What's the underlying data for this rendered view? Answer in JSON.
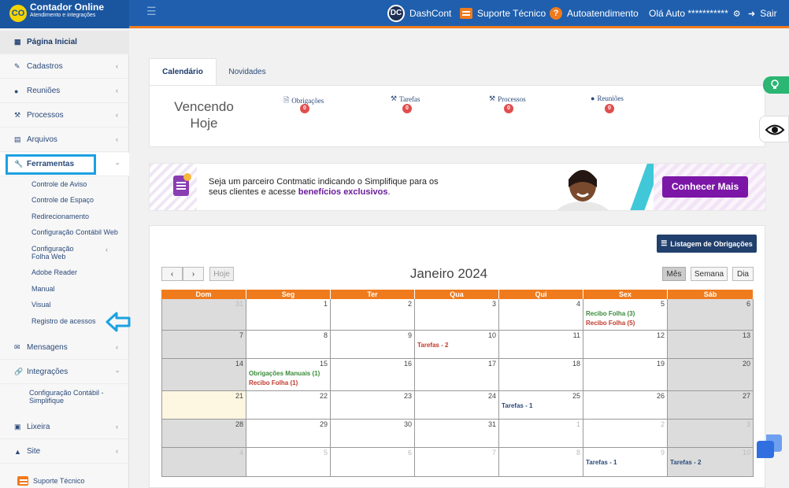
{
  "topbar": {
    "brand_logo": "CO",
    "brand_name": "Contador Online",
    "brand_sub": "Atendimento e integrações",
    "dashcont_logo": "DC",
    "dashcont": "DashCont",
    "suporte": "Suporte Técnico",
    "autoatendimento": "Autoatendimento",
    "user_greeting": "Olá Auto ***********",
    "sair": "Sair"
  },
  "sidebar": {
    "home": "Página Inicial",
    "items": [
      {
        "label": "Cadastros",
        "icon": "edit-icon"
      },
      {
        "label": "Reuniões",
        "icon": "users-icon"
      },
      {
        "label": "Processos",
        "icon": "gavel-icon"
      },
      {
        "label": "Arquivos",
        "icon": "file-icon"
      },
      {
        "label": "Ferramentas",
        "icon": "wrench-icon"
      },
      {
        "label": "Mensagens",
        "icon": "envelope-icon"
      },
      {
        "label": "Integrações",
        "icon": "link-icon"
      },
      {
        "label": "Lixeira",
        "icon": "trash-icon"
      },
      {
        "label": "Site",
        "icon": "sitemap-icon"
      }
    ],
    "ferramentas_sub": [
      "Controle de Aviso",
      "Controle de Espaço",
      "Redirecionamento",
      "Configuração Contábil Web",
      "Configuração Folha Web",
      "Adobe Reader",
      "Manual",
      "Visual",
      "Registro de acessos"
    ],
    "integracoes_sub": "Configuração Contábil - Simplifique",
    "suporte": "Suporte Técnico"
  },
  "tabs": [
    "Calendário",
    "Novidades"
  ],
  "summary": {
    "title": "Vencendo Hoje",
    "counters": [
      {
        "label": "Obrigações",
        "count": "0"
      },
      {
        "label": "Tarefas",
        "count": "0"
      },
      {
        "label": "Processos",
        "count": "0"
      },
      {
        "label": "Reuniões",
        "count": "0"
      }
    ]
  },
  "banner": {
    "text_start": "Seja um parceiro Contmatic indicando o Simplifique para os seus clientes e acesse ",
    "text_bold": "benefícios exclusivos",
    "text_end": ".",
    "cta": "Conhecer Mais"
  },
  "calendar": {
    "listagem_button": "Listagem de Obrigações",
    "hoje_button": "Hoje",
    "title": "Janeiro 2024",
    "views": [
      "Mês",
      "Semana",
      "Dia"
    ],
    "weekdays": [
      "Dom",
      "Seg",
      "Ter",
      "Qua",
      "Qui",
      "Sex",
      "Sáb"
    ],
    "weeks": [
      [
        {
          "d": "31",
          "o": 1
        },
        {
          "d": "1"
        },
        {
          "d": "2"
        },
        {
          "d": "3"
        },
        {
          "d": "4"
        },
        {
          "d": "5"
        },
        {
          "d": "6",
          "w": 1
        }
      ],
      [
        {
          "d": "7",
          "w": 1
        },
        {
          "d": "8"
        },
        {
          "d": "9"
        },
        {
          "d": "10"
        },
        {
          "d": "11"
        },
        {
          "d": "12"
        },
        {
          "d": "13",
          "w": 1
        }
      ],
      [
        {
          "d": "14",
          "w": 1
        },
        {
          "d": "15"
        },
        {
          "d": "16"
        },
        {
          "d": "17"
        },
        {
          "d": "18"
        },
        {
          "d": "19"
        },
        {
          "d": "20",
          "w": 1
        }
      ],
      [
        {
          "d": "21",
          "t": 1
        },
        {
          "d": "22"
        },
        {
          "d": "23"
        },
        {
          "d": "24"
        },
        {
          "d": "25"
        },
        {
          "d": "26"
        },
        {
          "d": "27",
          "w": 1
        }
      ],
      [
        {
          "d": "28",
          "w": 1
        },
        {
          "d": "29"
        },
        {
          "d": "30"
        },
        {
          "d": "31"
        },
        {
          "d": "1",
          "o": 2
        },
        {
          "d": "2",
          "o": 2
        },
        {
          "d": "3",
          "o": 1
        }
      ],
      [
        {
          "d": "4",
          "o": 1
        },
        {
          "d": "5",
          "o": 2
        },
        {
          "d": "6",
          "o": 2
        },
        {
          "d": "7",
          "o": 2
        },
        {
          "d": "8",
          "o": 2
        },
        {
          "d": "9",
          "o": 2
        },
        {
          "d": "10",
          "o": 1
        }
      ]
    ],
    "events": [
      {
        "week": 0,
        "day": 5,
        "line": 0,
        "text": "Recibo Folha (3)",
        "color": "#3a8a3a"
      },
      {
        "week": 0,
        "day": 5,
        "line": 1,
        "text": "Recibo Folha (5)",
        "color": "#c0392b"
      },
      {
        "week": 1,
        "day": 3,
        "line": 0,
        "text": "Tarefas - 2",
        "color": "#c0392b"
      },
      {
        "week": 2,
        "day": 1,
        "line": 0,
        "text": "Obrigações Manuais (1)",
        "color": "#3a8a3a"
      },
      {
        "week": 2,
        "day": 1,
        "line": 1,
        "text": "Recibo Folha (1)",
        "color": "#c0392b"
      },
      {
        "week": 3,
        "day": 4,
        "line": 0,
        "text": "Tarefas - 1",
        "color": "#2b4a7a"
      },
      {
        "week": 5,
        "day": 5,
        "line": 0,
        "text": "Tarefas - 1",
        "color": "#2b4a7a"
      },
      {
        "week": 5,
        "day": 6,
        "line": 0,
        "text": "Tarefas - 2",
        "color": "#2b4a7a"
      }
    ]
  },
  "colors": {
    "topbar": "#1f5fae",
    "accent_orange": "#f07b1d",
    "highlight_blue": "#1ba1e2",
    "cta_purple": "#7b16a7",
    "listagem_navy": "#21406d"
  }
}
